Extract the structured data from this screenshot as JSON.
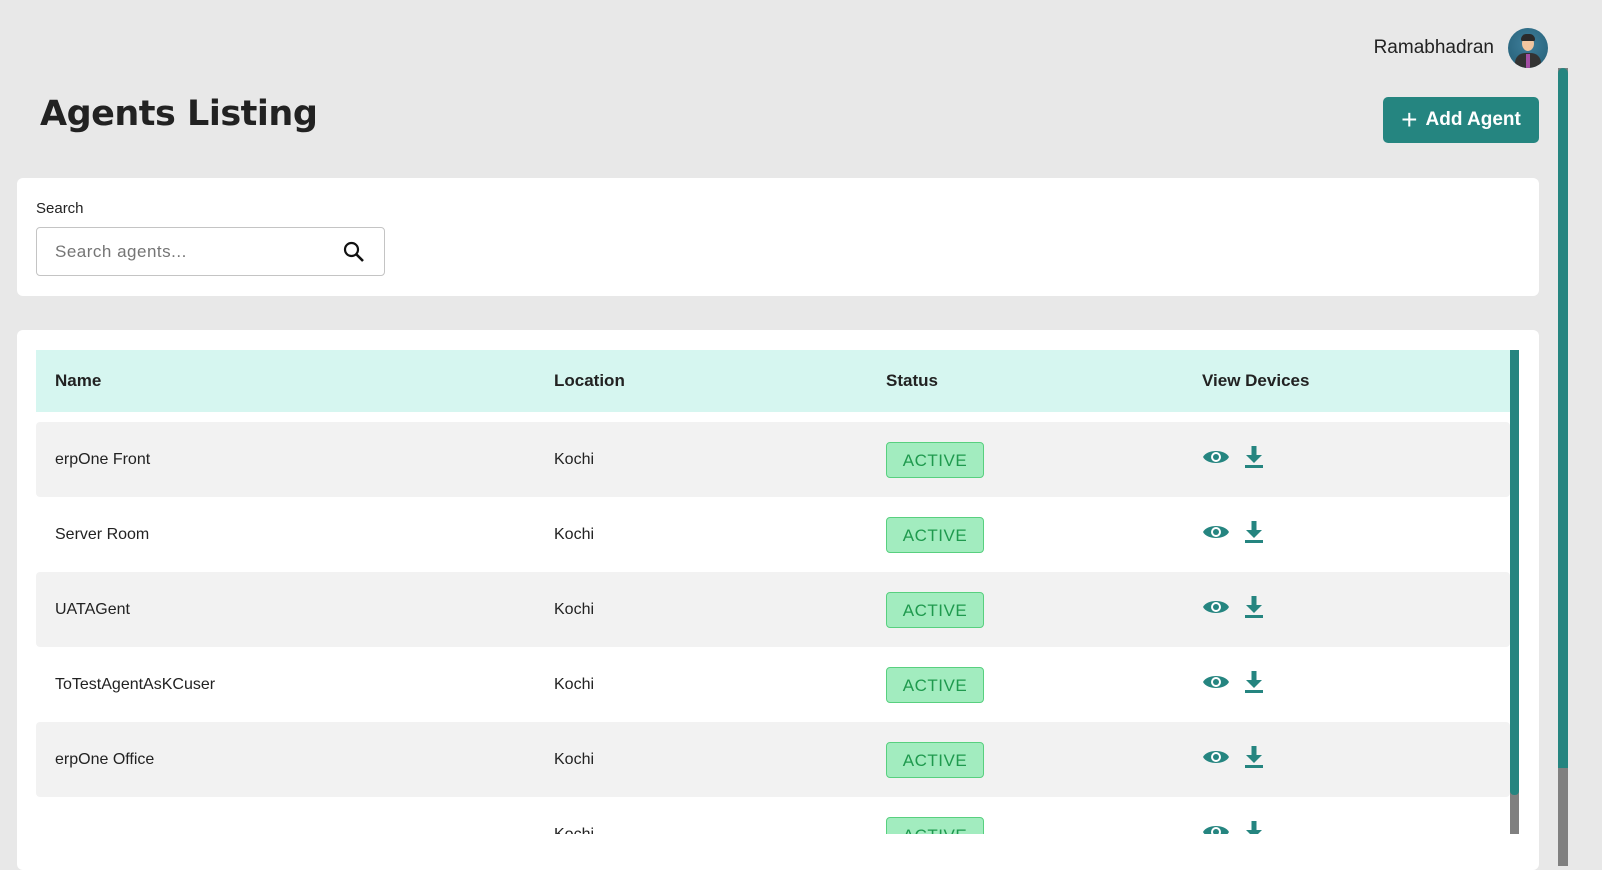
{
  "header": {
    "user_name": "Ramabhadran",
    "title": "Agents Listing",
    "add_button": "Add Agent"
  },
  "search": {
    "label": "Search",
    "placeholder": "Search agents..."
  },
  "table": {
    "columns": [
      "Name",
      "Location",
      "Status",
      "View Devices"
    ],
    "rows": [
      {
        "name": "erpOne Front",
        "location": "Kochi",
        "status": "ACTIVE"
      },
      {
        "name": "Server Room",
        "location": "Kochi",
        "status": "ACTIVE"
      },
      {
        "name": "UATAGent",
        "location": "Kochi",
        "status": "ACTIVE"
      },
      {
        "name": "ToTestAgentAsKCuser",
        "location": "Kochi",
        "status": "ACTIVE"
      },
      {
        "name": "erpOne Office",
        "location": "Kochi",
        "status": "ACTIVE"
      },
      {
        "name": "",
        "location": "Kochi",
        "status": "ACTIVE"
      }
    ]
  },
  "colors": {
    "accent": "#258580",
    "header_bg": "#d6f6f0",
    "badge_bg": "#a2ecbf",
    "badge_text": "#1f9a4e"
  }
}
